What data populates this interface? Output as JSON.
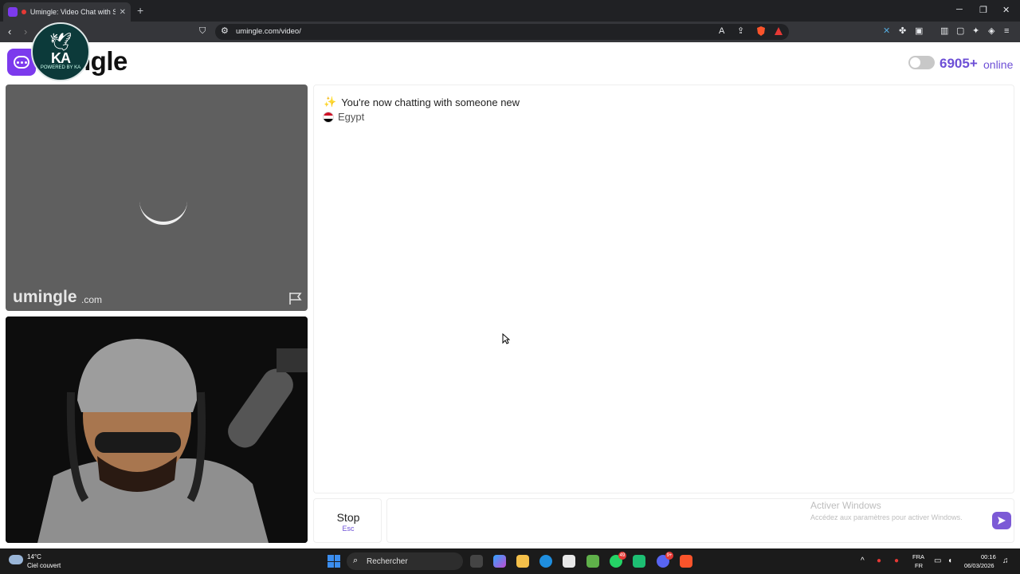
{
  "browser": {
    "tab_title": "Umingle: Video Chat with Stra",
    "url": "umingle.com/video/",
    "new_tab_glyph": "+",
    "tab_close_glyph": "✕"
  },
  "site": {
    "logo_text": "ngle",
    "brand_color": "#7c3aed",
    "online_count": "6905+",
    "online_label": "online",
    "watermark": "umingle",
    "watermark_suffix": ".com"
  },
  "overlay_logo": {
    "initials": "KA",
    "subtext": "POWERED BY KA"
  },
  "chat": {
    "system_message": "You're now chatting with someone new",
    "country": "Egypt"
  },
  "controls": {
    "stop_label": "Stop",
    "stop_shortcut": "Esc",
    "message_placeholder": ""
  },
  "windows_watermark": {
    "title": "Activer Windows",
    "subtitle": "Accédez aux paramètres pour activer Windows."
  },
  "taskbar": {
    "temperature": "14°C",
    "weather": "Ciel couvert",
    "search_label": "Rechercher",
    "whatsapp_badge": "49",
    "discord_badge": "9+",
    "lang_top": "FRA",
    "lang_bottom": "FR",
    "time": "00:16",
    "date": "06/03/2026"
  }
}
